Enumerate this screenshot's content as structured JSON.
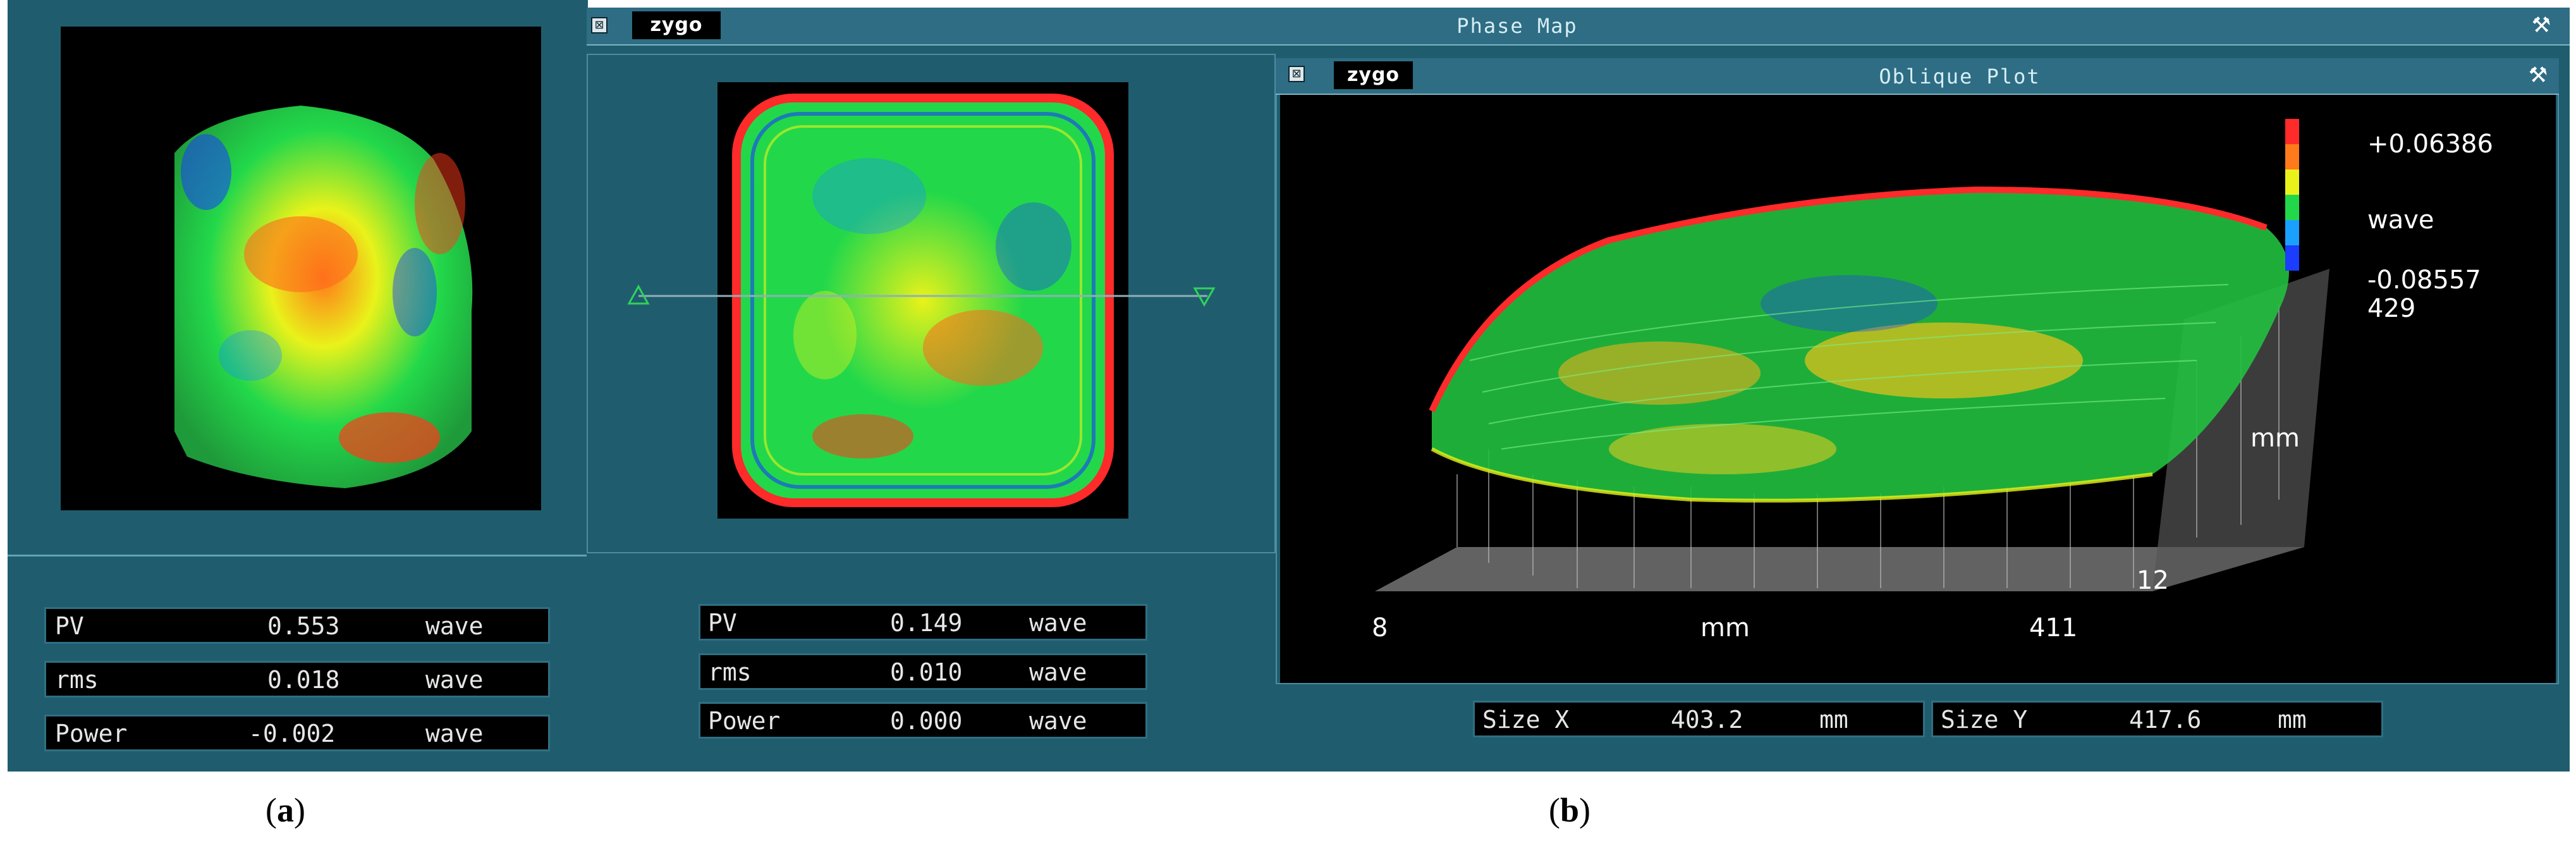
{
  "panel_a": {
    "stats": [
      {
        "label": "PV",
        "value": "0.553",
        "unit": "wave"
      },
      {
        "label": "rms",
        "value": "0.018",
        "unit": "wave"
      },
      {
        "label": "Power",
        "value": "-0.002",
        "unit": "wave"
      }
    ],
    "caption_open": "(",
    "caption_letter": "a",
    "caption_close": ")"
  },
  "panel_b": {
    "window": {
      "logo": "zygo",
      "title": "Phase Map",
      "close_glyph": "⊠",
      "wrench_glyph": "⚒"
    },
    "phase_stats": [
      {
        "label": "PV",
        "value": "0.149",
        "unit": "wave"
      },
      {
        "label": "rms",
        "value": "0.010",
        "unit": "wave"
      },
      {
        "label": "Power",
        "value": "0.000",
        "unit": "wave"
      }
    ],
    "oblique": {
      "logo": "zygo",
      "title": "Oblique Plot",
      "scale_max": "+0.06386",
      "scale_unit": "wave",
      "scale_min": "-0.08557",
      "scale_extra": "429",
      "axis_y_label": "mm",
      "axis_y_near": "12",
      "axis_x_start": "8",
      "axis_x_label": "mm",
      "axis_x_end": "411",
      "colors": {
        "high": "#ff2a2a",
        "mid_high": "#ffe600",
        "mid": "#22d84a",
        "low": "#1a3dff"
      }
    },
    "size": [
      {
        "label": "Size X",
        "value": "403.2",
        "unit": "mm"
      },
      {
        "label": "Size Y",
        "value": "417.6",
        "unit": "mm"
      }
    ],
    "caption_open": "(",
    "caption_letter": "b",
    "caption_close": ")"
  }
}
